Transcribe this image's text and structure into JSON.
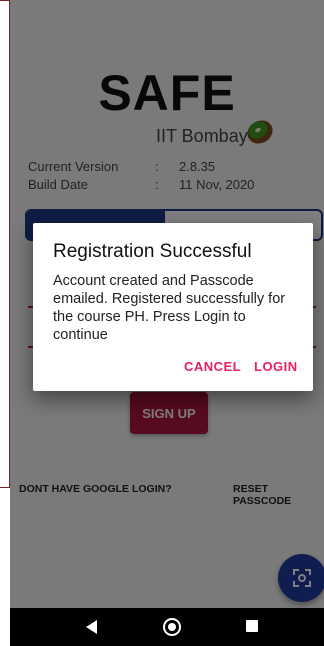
{
  "app": {
    "title": "SAFE",
    "subtitle": "IIT Bombay",
    "info": [
      {
        "label": "Current Version",
        "sep": ":",
        "value": "2.8.35"
      },
      {
        "label": "Build Date",
        "sep": ":",
        "value": "11 Nov, 2020"
      }
    ],
    "signup_label": "SIGN UP",
    "links": {
      "no_google": "DONT HAVE GOOGLE LOGIN?",
      "reset": "RESET PASSCODE"
    }
  },
  "dialog": {
    "title": "Registration Successful",
    "message": "Account created and Passcode emailed. Registered successfully for the course PH. Press Login to continue",
    "cancel": "CANCEL",
    "login": "LOGIN"
  },
  "colors": {
    "brand_blue": "#1e3a8a",
    "accent_pink": "#e91e63",
    "signup_red": "#b1163d"
  }
}
